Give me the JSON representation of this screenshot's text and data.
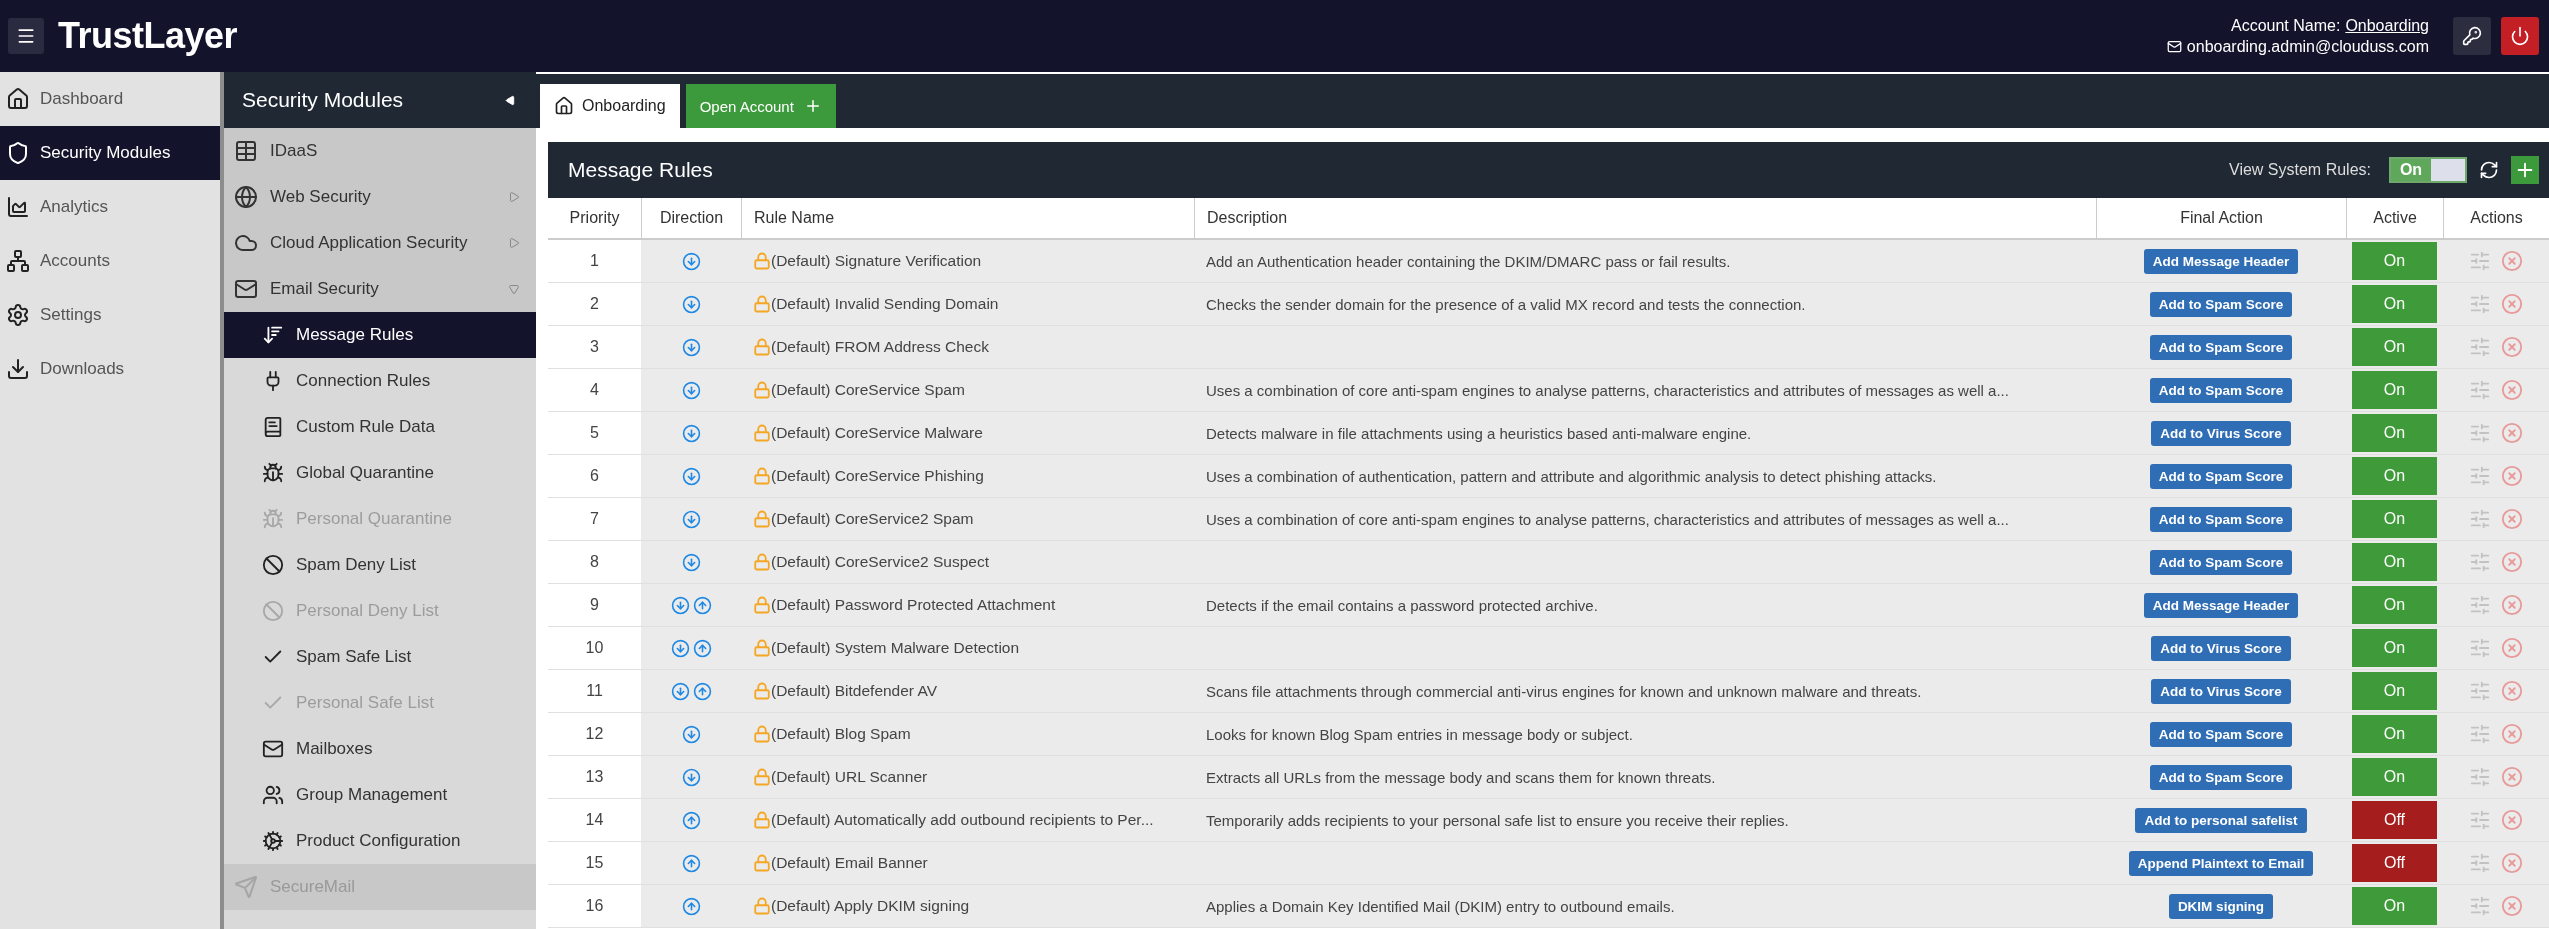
{
  "header": {
    "logo": "TrustLayer",
    "account_label": "Account Name:",
    "account_name": "Onboarding",
    "email": "onboarding.admin@clouduss.com"
  },
  "nav": [
    {
      "label": "Dashboard",
      "selected": false
    },
    {
      "label": "Security Modules",
      "selected": true
    },
    {
      "label": "Analytics",
      "selected": false
    },
    {
      "label": "Accounts",
      "selected": false
    },
    {
      "label": "Settings",
      "selected": false
    },
    {
      "label": "Downloads",
      "selected": false
    }
  ],
  "modules": {
    "title": "Security Modules",
    "items": [
      {
        "label": "IDaaS",
        "disabled": false
      },
      {
        "label": "Web Security",
        "disabled": false,
        "expanded": false
      },
      {
        "label": "Cloud Application Security",
        "disabled": false,
        "expanded": false
      },
      {
        "label": "Email Security",
        "disabled": false,
        "expanded": true,
        "children": [
          {
            "label": "Message Rules",
            "selected": true,
            "disabled": false
          },
          {
            "label": "Connection Rules",
            "selected": false,
            "disabled": false
          },
          {
            "label": "Custom Rule Data",
            "selected": false,
            "disabled": false
          },
          {
            "label": "Global Quarantine",
            "selected": false,
            "disabled": false
          },
          {
            "label": "Personal Quarantine",
            "selected": false,
            "disabled": true
          },
          {
            "label": "Spam Deny List",
            "selected": false,
            "disabled": false
          },
          {
            "label": "Personal Deny List",
            "selected": false,
            "disabled": true
          },
          {
            "label": "Spam Safe List",
            "selected": false,
            "disabled": false
          },
          {
            "label": "Personal Safe List",
            "selected": false,
            "disabled": true
          },
          {
            "label": "Mailboxes",
            "selected": false,
            "disabled": false
          },
          {
            "label": "Group Management",
            "selected": false,
            "disabled": false
          },
          {
            "label": "Product Configuration",
            "selected": false,
            "disabled": false
          }
        ]
      },
      {
        "label": "SecureMail",
        "disabled": true
      }
    ]
  },
  "tabs": [
    {
      "label": "Onboarding",
      "selected": true,
      "kind": "account"
    },
    {
      "label": "Open Account",
      "selected": false,
      "kind": "action"
    }
  ],
  "panel": {
    "title": "Message Rules",
    "system_rules": {
      "label": "View System Rules:",
      "value": "On",
      "on": true
    }
  },
  "table": {
    "columns": [
      "Priority",
      "Direction",
      "Rule Name",
      "Description",
      "Final Action",
      "Active",
      "Actions"
    ],
    "rows": [
      {
        "priority": "1",
        "direction": [
          {
            "kind": "in"
          }
        ],
        "name": "(Default) Signature Verification",
        "description": "Add an Authentication header containing the DKIM/DMARC pass or fail results.",
        "final_action": "Add Message Header",
        "active": {
          "label": "On",
          "on": true
        }
      },
      {
        "priority": "2",
        "direction": [
          {
            "kind": "in"
          }
        ],
        "name": "(Default) Invalid Sending Domain",
        "description": "Checks the sender domain for the presence of a valid MX record and tests the connection.",
        "final_action": "Add to Spam Score",
        "active": {
          "label": "On",
          "on": true
        }
      },
      {
        "priority": "3",
        "direction": [
          {
            "kind": "in"
          }
        ],
        "name": "(Default) FROM Address Check",
        "final_action": "Add to Spam Score",
        "active": {
          "label": "On",
          "on": true
        }
      },
      {
        "priority": "4",
        "direction": [
          {
            "kind": "in"
          }
        ],
        "name": "(Default) CoreService Spam",
        "description": "Uses a combination of core anti-spam engines to analyse patterns, characteristics and attributes of messages as well a...",
        "final_action": "Add to Spam Score",
        "active": {
          "label": "On",
          "on": true
        }
      },
      {
        "priority": "5",
        "direction": [
          {
            "kind": "in"
          }
        ],
        "name": "(Default) CoreService Malware",
        "description": "Detects malware in file attachments using a heuristics based anti-malware engine.",
        "final_action": "Add to Virus Score",
        "active": {
          "label": "On",
          "on": true
        }
      },
      {
        "priority": "6",
        "direction": [
          {
            "kind": "in"
          }
        ],
        "name": "(Default) CoreService Phishing",
        "description": "Uses a combination of authentication, pattern and attribute and algorithmic analysis to detect phishing attacks.",
        "final_action": "Add to Spam Score",
        "active": {
          "label": "On",
          "on": true
        }
      },
      {
        "priority": "7",
        "direction": [
          {
            "kind": "in"
          }
        ],
        "name": "(Default) CoreService2 Spam",
        "description": "Uses a combination of core anti-spam engines to analyse patterns, characteristics and attributes of messages as well a...",
        "final_action": "Add to Spam Score",
        "active": {
          "label": "On",
          "on": true
        }
      },
      {
        "priority": "8",
        "direction": [
          {
            "kind": "in"
          }
        ],
        "name": "(Default) CoreService2 Suspect",
        "final_action": "Add to Spam Score",
        "active": {
          "label": "On",
          "on": true
        }
      },
      {
        "priority": "9",
        "direction": [
          {
            "kind": "in"
          },
          {
            "kind": "out"
          }
        ],
        "name": "(Default) Password Protected Attachment",
        "description": "Detects if the email contains a password protected archive.",
        "final_action": "Add Message Header",
        "active": {
          "label": "On",
          "on": true
        }
      },
      {
        "priority": "10",
        "direction": [
          {
            "kind": "in"
          },
          {
            "kind": "out"
          }
        ],
        "name": "(Default) System Malware Detection",
        "final_action": "Add to Virus Score",
        "active": {
          "label": "On",
          "on": true
        }
      },
      {
        "priority": "11",
        "direction": [
          {
            "kind": "in"
          },
          {
            "kind": "out"
          }
        ],
        "name": "(Default) Bitdefender AV",
        "description": "Scans file attachments through commercial anti-virus engines for known and unknown malware and threats.",
        "final_action": "Add to Virus Score",
        "active": {
          "label": "On",
          "on": true
        }
      },
      {
        "priority": "12",
        "direction": [
          {
            "kind": "in"
          }
        ],
        "name": "(Default) Blog Spam",
        "description": "Looks for known Blog Spam entries in message body or subject.",
        "final_action": "Add to Spam Score",
        "active": {
          "label": "On",
          "on": true
        }
      },
      {
        "priority": "13",
        "direction": [
          {
            "kind": "in"
          }
        ],
        "name": "(Default) URL Scanner",
        "description": "Extracts all URLs from the message body and scans them for known threats.",
        "final_action": "Add to Spam Score",
        "active": {
          "label": "On",
          "on": true
        }
      },
      {
        "priority": "14",
        "direction": [
          {
            "kind": "out"
          }
        ],
        "name": "(Default) Automatically add outbound recipients to Per...",
        "description": "Temporarily adds recipients to your personal safe list to ensure you receive their replies.",
        "final_action": "Add to personal safelist",
        "active": {
          "label": "Off",
          "on": false
        }
      },
      {
        "priority": "15",
        "direction": [
          {
            "kind": "out"
          }
        ],
        "name": "(Default) Email Banner",
        "final_action": "Append Plaintext to Email",
        "active": {
          "label": "Off",
          "on": false
        }
      },
      {
        "priority": "16",
        "direction": [
          {
            "kind": "out"
          }
        ],
        "name": "(Default) Apply DKIM signing",
        "description": "Applies a Domain Key Identified Mail (DKIM) entry to outbound emails.",
        "final_action": "DKIM signing",
        "active": {
          "label": "On",
          "on": true
        }
      }
    ]
  }
}
